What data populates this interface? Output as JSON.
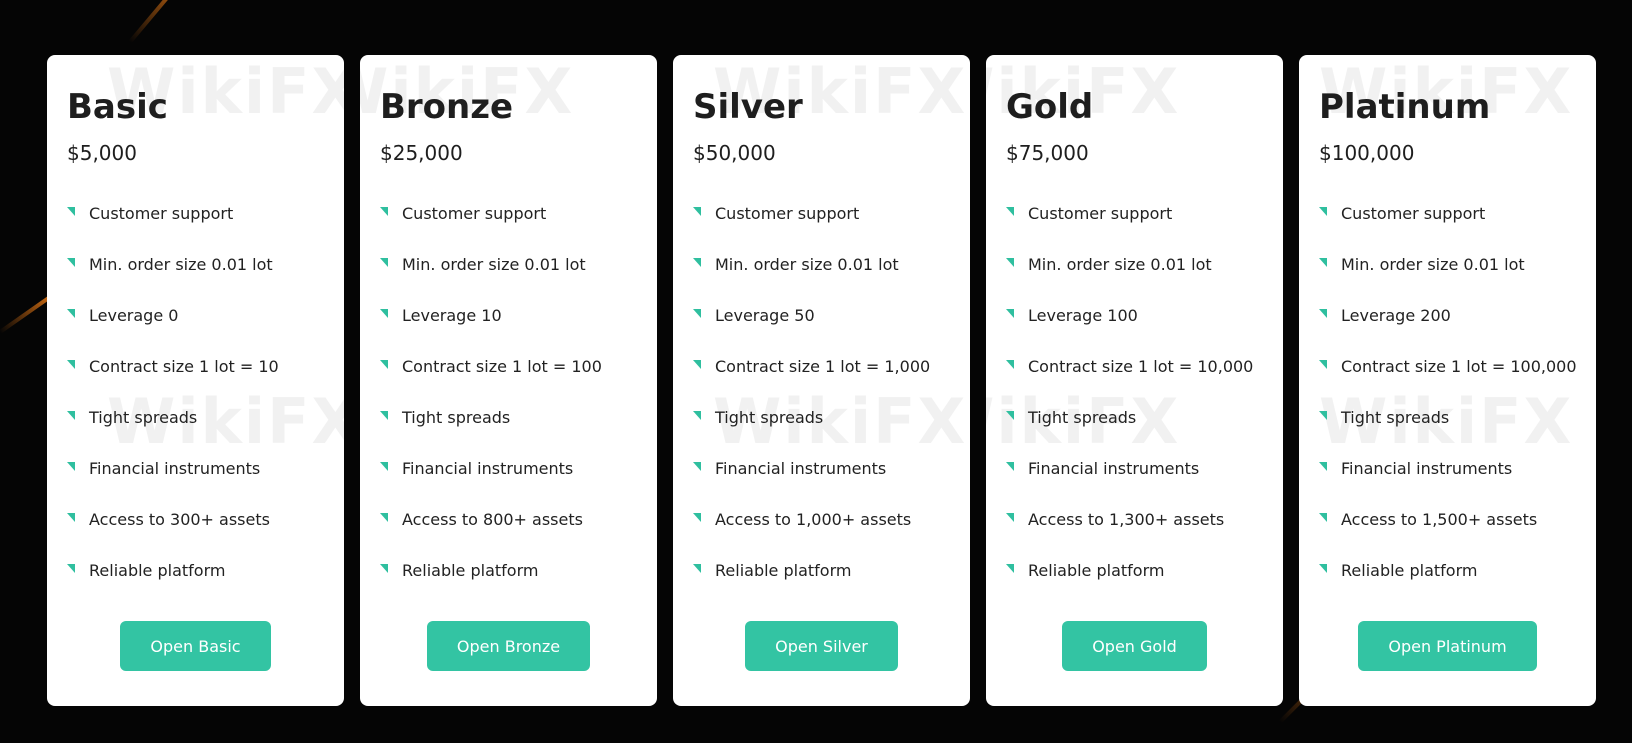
{
  "watermark_text": "WikiFX",
  "colors": {
    "accent": "#33c4a3",
    "bullet": "#2fbf9f",
    "background": "#050505",
    "card": "#ffffff",
    "streak": "#e67814"
  },
  "plans": [
    {
      "name": "Basic",
      "price": "$5,000",
      "features": [
        "Customer support",
        "Min. order size 0.01 lot",
        "Leverage 0",
        "Contract size 1 lot = 10",
        "Tight spreads",
        "Financial instruments",
        "Access to 300+ assets",
        "Reliable platform"
      ],
      "button_label": "Open Basic"
    },
    {
      "name": "Bronze",
      "price": "$25,000",
      "features": [
        "Customer support",
        "Min. order size 0.01 lot",
        "Leverage 10",
        "Contract size 1 lot = 100",
        "Tight spreads",
        "Financial instruments",
        "Access to 800+ assets",
        "Reliable platform"
      ],
      "button_label": "Open Bronze"
    },
    {
      "name": "Silver",
      "price": "$50,000",
      "features": [
        "Customer support",
        "Min. order size 0.01 lot",
        "Leverage 50",
        "Contract size 1 lot = 1,000",
        "Tight spreads",
        "Financial instruments",
        "Access to 1,000+ assets",
        "Reliable platform"
      ],
      "button_label": "Open Silver"
    },
    {
      "name": "Gold",
      "price": "$75,000",
      "features": [
        "Customer support",
        "Min. order size 0.01 lot",
        "Leverage 100",
        "Contract size 1 lot = 10,000",
        "Tight spreads",
        "Financial instruments",
        "Access to 1,300+ assets",
        "Reliable platform"
      ],
      "button_label": "Open Gold"
    },
    {
      "name": "Platinum",
      "price": "$100,000",
      "features": [
        "Customer support",
        "Min. order size 0.01 lot",
        "Leverage 200",
        "Contract size 1 lot = 100,000",
        "Tight spreads",
        "Financial instruments",
        "Access to 1,500+ assets",
        "Reliable platform"
      ],
      "button_label": "Open Platinum"
    }
  ]
}
